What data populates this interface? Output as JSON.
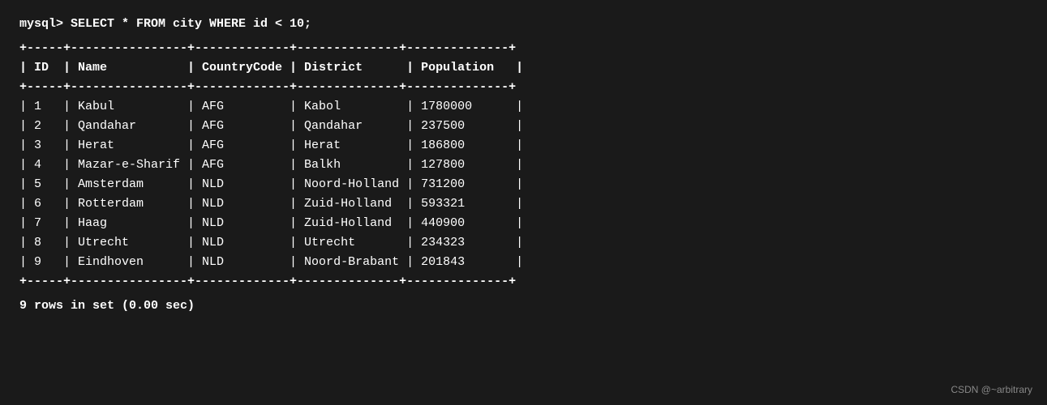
{
  "query": "mysql> SELECT * FROM city WHERE id < 10;",
  "divider": "+-----+----------------+-------------+--------------+--------------+",
  "header": "| ID  | Name           | CountryCode | District      | Population   |",
  "rows": [
    "| 1   | Kabul          | AFG         | Kabol         | 1780000      |",
    "| 2   | Qandahar       | AFG         | Qandahar      | 237500       |",
    "| 3   | Herat          | AFG         | Herat         | 186800       |",
    "| 4   | Mazar-e-Sharif | AFG         | Balkh         | 127800       |",
    "| 5   | Amsterdam      | NLD         | Noord-Holland | 731200       |",
    "| 6   | Rotterdam      | NLD         | Zuid-Holland  | 593321       |",
    "| 7   | Haag           | NLD         | Zuid-Holland  | 440900       |",
    "| 8   | Utrecht        | NLD         | Utrecht       | 234323       |",
    "| 9   | Eindhoven      | NLD         | Noord-Brabant | 201843       |"
  ],
  "footer": "9 rows in set (0.00 sec)",
  "watermark": "CSDN @~arbitrary"
}
